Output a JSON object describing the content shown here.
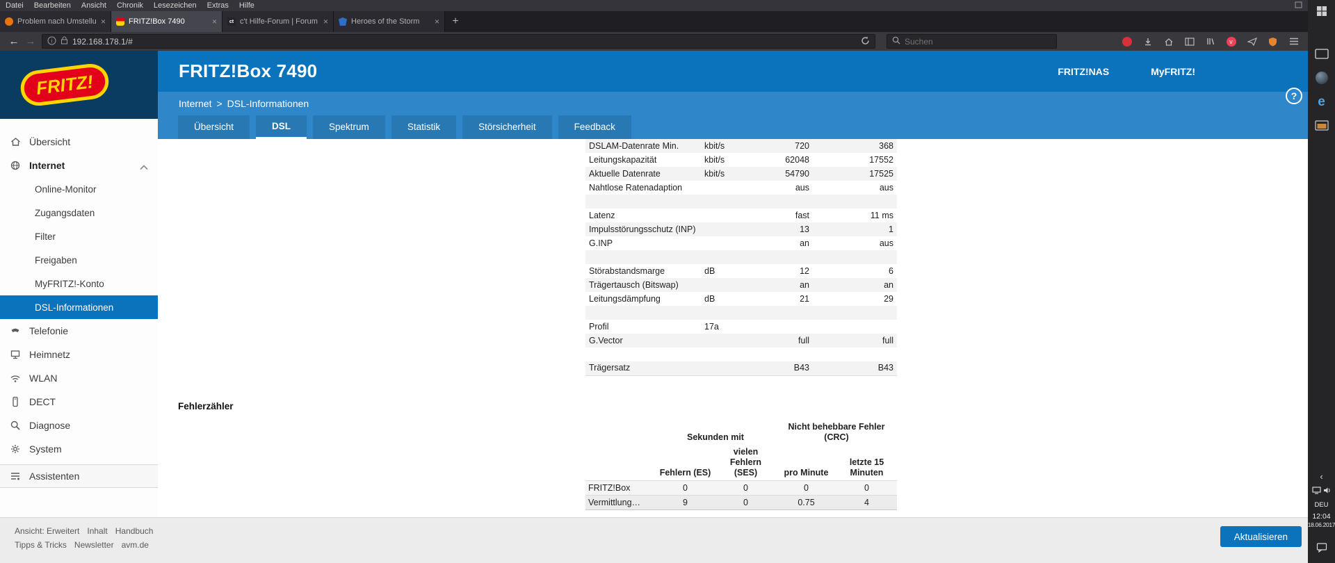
{
  "menubar": {
    "items": [
      "Datei",
      "Bearbeiten",
      "Ansicht",
      "Chronik",
      "Lesezeichen",
      "Extras",
      "Hilfe"
    ]
  },
  "browser_tabs": {
    "list": [
      {
        "title": "Problem nach Umstellung a",
        "close": "×"
      },
      {
        "title": "FRITZ!Box 7490",
        "close": "×"
      },
      {
        "title": "c't Hilfe-Forum | Forum - h",
        "close": "×"
      },
      {
        "title": "Heroes of the Storm",
        "close": "×"
      }
    ],
    "new_tab": "+"
  },
  "navbar": {
    "back": "←",
    "forward": "←",
    "url": "192.168.178.1/#",
    "search_placeholder": "Suchen"
  },
  "glyphs": {
    "ct": "ct",
    "edge": "e",
    "help": "?",
    "chevron_left": "‹",
    "info": "i",
    "pocket": "v"
  },
  "header": {
    "title": "FRITZ!Box 7490",
    "links": [
      "FRITZ!NAS",
      "MyFRITZ!"
    ]
  },
  "breadcrumb": {
    "section": "Internet",
    "separator": ">",
    "page": "DSL-Informationen"
  },
  "page_tabs": [
    "Übersicht",
    "DSL",
    "Spektrum",
    "Statistik",
    "Störsicherheit",
    "Feedback"
  ],
  "sidebar": {
    "logo": "FRITZ!",
    "items": [
      "Übersicht",
      "Internet",
      "Online-Monitor",
      "Zugangsdaten",
      "Filter",
      "Freigaben",
      "MyFRITZ!-Konto",
      "DSL-Informationen",
      "Telefonie",
      "Heimnetz",
      "WLAN",
      "DECT",
      "Diagnose",
      "System",
      "Assistenten"
    ]
  },
  "dsl_table": {
    "rows": [
      {
        "label": "DSLAM-Datenrate Min.",
        "unit": "kbit/s",
        "down": "720",
        "up": "368"
      },
      {
        "label": "Leitungskapazität",
        "unit": "kbit/s",
        "down": "62048",
        "up": "17552"
      },
      {
        "label": "Aktuelle Datenrate",
        "unit": "kbit/s",
        "down": "54790",
        "up": "17525"
      },
      {
        "label": "Nahtlose Ratenadaption",
        "unit": "",
        "down": "aus",
        "up": "aus"
      },
      {
        "label": "",
        "unit": "",
        "down": "",
        "up": ""
      },
      {
        "label": "Latenz",
        "unit": "",
        "down": "fast",
        "up": "11 ms"
      },
      {
        "label": "Impulsstörungsschutz (INP)",
        "unit": "",
        "down": "13",
        "up": "1"
      },
      {
        "label": "G.INP",
        "unit": "",
        "down": "an",
        "up": "aus"
      },
      {
        "label": "",
        "unit": "",
        "down": "",
        "up": ""
      },
      {
        "label": "Störabstandsmarge",
        "unit": "dB",
        "down": "12",
        "up": "6"
      },
      {
        "label": "Trägertausch (Bitswap)",
        "unit": "",
        "down": "an",
        "up": "an"
      },
      {
        "label": "Leitungsdämpfung",
        "unit": "dB",
        "down": "21",
        "up": "29"
      },
      {
        "label": "",
        "unit": "",
        "down": "",
        "up": ""
      },
      {
        "label": "Profil",
        "unit": "17a",
        "down": "",
        "up": ""
      },
      {
        "label": "G.Vector",
        "unit": "",
        "down": "full",
        "up": "full"
      },
      {
        "label": "",
        "unit": "",
        "down": "",
        "up": ""
      },
      {
        "label": "Trägersatz",
        "unit": "",
        "down": "B43",
        "up": "B43"
      }
    ]
  },
  "errors": {
    "heading": "Fehlerzähler",
    "group1": "Sekunden mit",
    "group2": "Nicht behebbare Fehler (CRC)",
    "cols": [
      "Fehlern (ES)",
      "vielen Fehlern (SES)",
      "pro Minute",
      "letzte 15 Minuten"
    ],
    "rows": [
      {
        "label": "FRITZ!Box",
        "values": [
          "0",
          "0",
          "0",
          "0"
        ]
      },
      {
        "label": "Vermittlung…",
        "values": [
          "9",
          "0",
          "0.75",
          "4"
        ]
      }
    ]
  },
  "footer": {
    "links_row1": [
      "Ansicht: Erweitert",
      "Inhalt",
      "Handbuch"
    ],
    "links_row2": [
      "Tipps & Tricks",
      "Newsletter",
      "avm.de"
    ],
    "button": "Aktualisieren"
  },
  "taskbar": {
    "lang": "DEU",
    "time": "12:04",
    "date": "18.06.2017"
  }
}
